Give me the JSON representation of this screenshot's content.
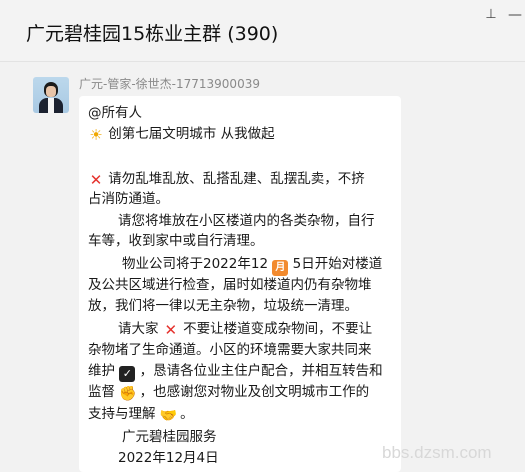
{
  "window": {
    "title": "广元碧桂园15栋业主群 (390)",
    "pin_icon": "pin-icon",
    "minimize_icon": "minimize-icon"
  },
  "message": {
    "sender": "广元-管家-徐世杰-17713900039",
    "lines": [
      "@所有人",
      "创第七届文明城市 从我做起",
      "请勿乱堆乱放、乱搭乱建、乱摆乱卖，不挤",
      "占消防通道。",
      "请您将堆放在小区楼道内的各类杂物，自行",
      "车等，收到家中或自行清理。",
      "物业公司将于2022年12",
      "5日开始对楼道",
      "及公共区域进行检查，届时如楼道内仍有杂物堆",
      "放，我们将一律以无主杂物，垃圾统一清理。",
      "请大家",
      "不要让楼道变成杂物间，不要让",
      "杂物堵了生命通道。小区的环境需要大家共同来",
      "维护",
      "，恳请各位业主住户配合，并相互转告和",
      "监督",
      "，也感谢您对物业及创文明城市工作的",
      "支持与理解",
      "。",
      "广元碧桂园服务",
      "2022年12月4日"
    ],
    "emojis": {
      "sun": "☀",
      "cross": "✕",
      "calendar": "月",
      "check": "✓",
      "hand": "✊",
      "handshake": "🤝"
    }
  },
  "watermark": "bbs.dzsm.com"
}
